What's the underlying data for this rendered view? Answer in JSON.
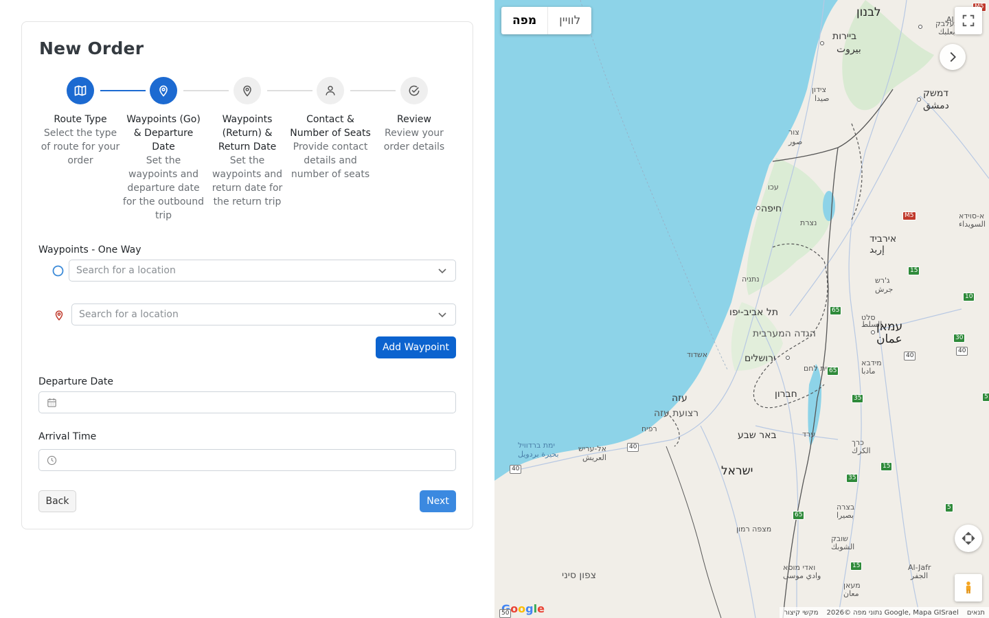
{
  "form": {
    "title": "New Order",
    "steps": [
      {
        "title": "Route Type",
        "desc": "Select the type of route for your order",
        "state": "active",
        "icon": "map-icon"
      },
      {
        "title": "Waypoints (Go) & Departure Date",
        "desc": "Set the waypoints and departure date for the outbound trip",
        "state": "active",
        "icon": "location-pin-icon"
      },
      {
        "title": "Waypoints (Return) & Return Date",
        "desc": "Set the waypoints and return date for the return trip",
        "state": "inactive",
        "icon": "location-pin-icon"
      },
      {
        "title": "Contact & Number of Seats",
        "desc": "Provide contact details and number of seats",
        "state": "inactive",
        "icon": "user-icon"
      },
      {
        "title": "Review",
        "desc": "Review your order details",
        "state": "inactive",
        "icon": "check-circle-icon"
      }
    ],
    "waypoints_label": "Waypoints - One Way",
    "origin_placeholder": "Search for a location",
    "destination_placeholder": "Search for a location",
    "add_waypoint_label": "Add Waypoint",
    "departure_date_label": "Departure Date",
    "arrival_time_label": "Arrival Time",
    "back_label": "Back",
    "next_label": "Next"
  },
  "map": {
    "type_map": "מפה",
    "type_satellite": "לוויין",
    "places": {
      "lebanon": "לבנון",
      "beirut": "ביירות",
      "beirut_ar": "بيروت",
      "baalbek": "בעלבק",
      "baalbek_ar": "بعلبك",
      "sidon": "צידון",
      "sidon_ar": "صيدا",
      "damascus": "דמשק",
      "damascus_ar": "دمشق",
      "tyre": "צור",
      "tyre_ar": "صور",
      "acre": "עכו",
      "haifa": "חיפה",
      "nazareth": "נצרת",
      "irbid": "אירביד",
      "irbid_ar": "إربد",
      "sweida": "א-סוידא",
      "sweida_ar": "السويداء",
      "netanya": "נתניה",
      "jerash": "ג'רש",
      "jerash_ar": "جرش",
      "tel_aviv": "תל אביב-יפו",
      "salt": "סלט",
      "salt_ar": "السلط",
      "amman": "עמאן",
      "amman_ar": "عمان",
      "west_bank": "הגדה המערבית",
      "ashdod": "אשדוד",
      "jerusalem": "ירושלים",
      "bethlehem": "בית לחם",
      "madaba": "מידבא",
      "madaba_ar": "مادبا",
      "gaza": "עזה",
      "hebron": "חברון",
      "gaza_strip": "רצועת עזה",
      "rafah": "רפיח",
      "beersheba": "באר שבע",
      "arad": "ערד",
      "bardawil": "ימת ברדוויל",
      "bardawil_ar": "بحيرة بردويل",
      "arish": "אל-עריש",
      "arish_ar": "العريش",
      "karak": "כרך",
      "karak_ar": "الكرك",
      "israel": "ישראל",
      "bozra": "בצרה",
      "bozra_ar": "بصيرا",
      "mitzpe_ramon": "מצפה רמון",
      "shobak": "שובק",
      "shobak_ar": "الشوبك",
      "north_sinai": "צפון סיני",
      "wadi_musa": "ואדי מוסא",
      "wadi_musa_ar": "وادي موسى",
      "al_jafr": "Al-Jafr",
      "al_jafr_ar": "الجفر",
      "maan": "מעאן",
      "maan_ar": "معان",
      "al": "Al"
    },
    "shields": {
      "m5": "M5",
      "r15": "15",
      "r10": "10",
      "r65": "65",
      "r30": "30",
      "r40": "40",
      "r35": "35",
      "r5": "5",
      "r50": "50"
    },
    "google": "Google",
    "attr_data": "נתוני מפה ©2026 Google, Mapa GISrael",
    "attr_shortcuts": "מקשי קיצור",
    "attr_terms": "תנאים"
  }
}
